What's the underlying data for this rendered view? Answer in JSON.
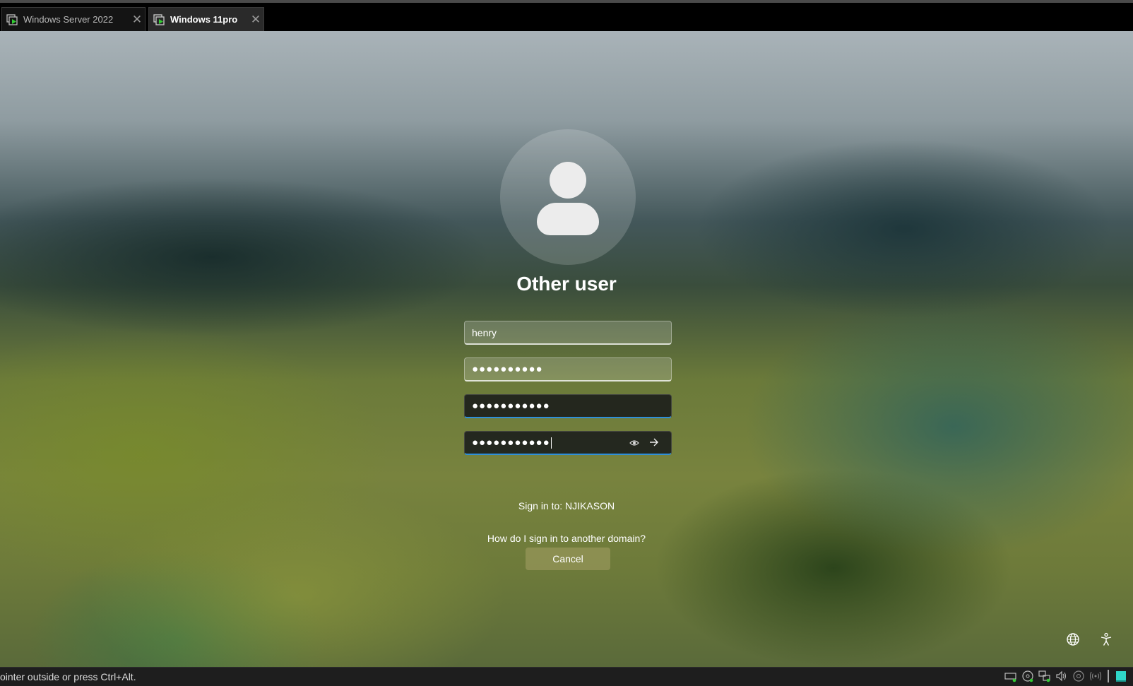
{
  "tabs": [
    {
      "label": "Windows Server 2022",
      "icon": "vm-icon",
      "active": false
    },
    {
      "label": "Windows 11pro",
      "icon": "vm-icon",
      "active": true
    }
  ],
  "close_glyph": "✕",
  "login": {
    "title": "Other user",
    "username_value": "henry",
    "password_value": "●●●●●●●●●●",
    "new_password_value": "●●●●●●●●●●●",
    "confirm_password_value": "●●●●●●●●●●●",
    "reveal_icon": "eye-icon",
    "submit_icon": "arrow-right-icon",
    "signin_to": "Sign in to: NJIKASON",
    "help_link": "How do I sign in to another domain?",
    "cancel_label": "Cancel"
  },
  "corner_icons": [
    "network-icon",
    "accessibility-icon"
  ],
  "status": {
    "message": "ointer outside or press Ctrl+Alt.",
    "tray_icons": [
      "hard-disk-icon",
      "cd-drive-icon",
      "network-adapter-icon",
      "sound-icon",
      "usb-icon",
      "wireless-icon",
      "vm-display-icon"
    ]
  },
  "colors": {
    "focus_underline": "#2f8fd8",
    "tray_active": "#2fd6c8",
    "vm_icon_green": "#33cc33"
  }
}
